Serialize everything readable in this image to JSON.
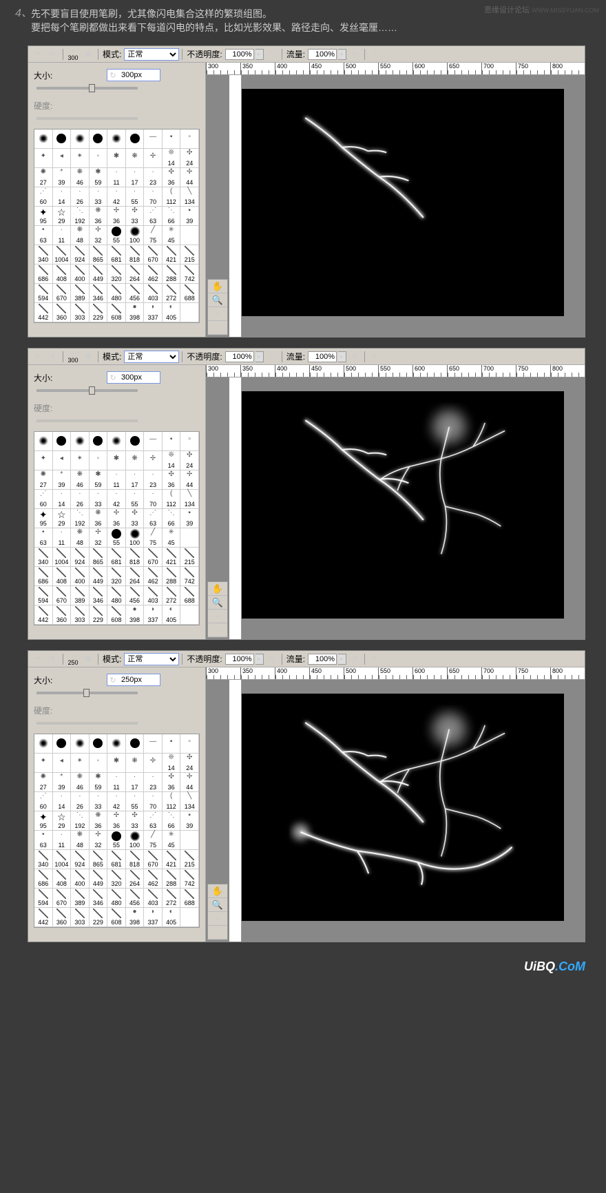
{
  "step_number": "4、",
  "instruction_line1": "先不要盲目使用笔刷，尤其像闪电集合这样的繁琐组图。",
  "instruction_line2": "要把每个笔刷都做出来看下每道闪电的特点，比如光影效果、路径走向、发丝毫厘……",
  "watermark": "思缘设计论坛",
  "watermark_url": "WWW.MISSYUAN.COM",
  "toolbar": {
    "mode_label": "模式:",
    "mode_value": "正常",
    "opacity_label": "不透明度:",
    "opacity_value": "100%",
    "flow_label": "流量:",
    "flow_value": "100%"
  },
  "brush_panel": {
    "size_label": "大小:",
    "hardness_label": "硬度:"
  },
  "panels": [
    {
      "brush_size_num": "300",
      "size_value": "300px",
      "lightning_count": 1,
      "slider_pos": "52%"
    },
    {
      "brush_size_num": "300",
      "size_value": "300px",
      "lightning_count": 2,
      "slider_pos": "52%"
    },
    {
      "brush_size_num": "250",
      "size_value": "250px",
      "lightning_count": 3,
      "slider_pos": "46%"
    }
  ],
  "ruler_ticks": [
    "300",
    "350",
    "400",
    "450",
    "500",
    "550",
    "600",
    "650",
    "700",
    "750",
    "800"
  ],
  "brush_grid": [
    [
      {
        "s": "circle-soft",
        "v": ""
      },
      {
        "s": "circle-solid",
        "v": ""
      },
      {
        "s": "circle-soft",
        "v": ""
      },
      {
        "s": "circle-solid",
        "v": ""
      },
      {
        "s": "circle-soft",
        "v": ""
      },
      {
        "s": "circle-solid",
        "v": ""
      },
      {
        "s": "scatter",
        "v": "",
        "t": "—"
      },
      {
        "s": "scatter",
        "v": "",
        "t": "▪"
      },
      {
        "s": "scatter",
        "v": "",
        "t": "▫"
      }
    ],
    [
      {
        "s": "scatter",
        "v": "",
        "t": "✦"
      },
      {
        "s": "scatter",
        "v": "",
        "t": "◂"
      },
      {
        "s": "scatter",
        "v": "",
        "t": "✴"
      },
      {
        "s": "scatter",
        "v": "",
        "t": "◦"
      },
      {
        "s": "scatter",
        "v": "",
        "t": "✱"
      },
      {
        "s": "scatter",
        "v": "",
        "t": "❋"
      },
      {
        "s": "scatter",
        "v": "",
        "t": "✢"
      },
      {
        "s": "scatter",
        "v": "14",
        "t": "❊"
      },
      {
        "s": "scatter",
        "v": "24",
        "t": "✣"
      }
    ],
    [
      {
        "s": "scatter",
        "v": "27",
        "t": "✺"
      },
      {
        "s": "scatter",
        "v": "39",
        "t": "*"
      },
      {
        "s": "scatter",
        "v": "46",
        "t": "❋"
      },
      {
        "s": "scatter",
        "v": "59",
        "t": "✱"
      },
      {
        "s": "scatter",
        "v": "11",
        "t": "·"
      },
      {
        "s": "scatter",
        "v": "17",
        "t": "·"
      },
      {
        "s": "scatter",
        "v": "23",
        "t": "·"
      },
      {
        "s": "scatter",
        "v": "36",
        "t": "✣"
      },
      {
        "s": "scatter",
        "v": "44",
        "t": "✢"
      }
    ],
    [
      {
        "s": "scatter",
        "v": "60",
        "t": "⋰"
      },
      {
        "s": "scatter",
        "v": "14",
        "t": "·"
      },
      {
        "s": "scatter",
        "v": "26",
        "t": "·"
      },
      {
        "s": "scatter",
        "v": "33",
        "t": "·"
      },
      {
        "s": "scatter",
        "v": "42",
        "t": "·"
      },
      {
        "s": "scatter",
        "v": "55",
        "t": "·"
      },
      {
        "s": "scatter",
        "v": "70",
        "t": "·"
      },
      {
        "s": "scatter",
        "v": "112",
        "t": "("
      },
      {
        "s": "scatter",
        "v": "134",
        "t": "╲"
      }
    ],
    [
      {
        "s": "star",
        "v": "95",
        "t": "✦"
      },
      {
        "s": "star",
        "v": "29",
        "t": "☆"
      },
      {
        "s": "scatter",
        "v": "192",
        "t": "⋱"
      },
      {
        "s": "scatter",
        "v": "36",
        "t": "❋"
      },
      {
        "s": "scatter",
        "v": "36",
        "t": "✢"
      },
      {
        "s": "scatter",
        "v": "33",
        "t": "✣"
      },
      {
        "s": "scatter",
        "v": "63",
        "t": "⋰"
      },
      {
        "s": "scatter",
        "v": "66",
        "t": "⋱"
      },
      {
        "s": "scatter",
        "v": "39",
        "t": "▪"
      }
    ],
    [
      {
        "s": "scatter",
        "v": "63",
        "t": "•"
      },
      {
        "s": "scatter",
        "v": "11",
        "t": "·"
      },
      {
        "s": "scatter",
        "v": "48",
        "t": "❋"
      },
      {
        "s": "scatter",
        "v": "32",
        "t": "✢"
      },
      {
        "s": "circle-solid",
        "v": "55"
      },
      {
        "s": "circle-med",
        "v": "100"
      },
      {
        "s": "scatter",
        "v": "75",
        "t": "╱"
      },
      {
        "s": "scatter",
        "v": "45",
        "t": "✳"
      },
      {
        "s": "",
        "v": ""
      }
    ],
    [
      {
        "s": "stroke",
        "v": "340"
      },
      {
        "s": "stroke",
        "v": "1004"
      },
      {
        "s": "stroke",
        "v": "924"
      },
      {
        "s": "stroke",
        "v": "865"
      },
      {
        "s": "stroke",
        "v": "681"
      },
      {
        "s": "stroke",
        "v": "818"
      },
      {
        "s": "stroke",
        "v": "670"
      },
      {
        "s": "stroke",
        "v": "421"
      },
      {
        "s": "stroke",
        "v": "215"
      }
    ],
    [
      {
        "s": "stroke",
        "v": "686"
      },
      {
        "s": "stroke",
        "v": "408"
      },
      {
        "s": "stroke",
        "v": "400"
      },
      {
        "s": "stroke",
        "v": "449"
      },
      {
        "s": "stroke",
        "v": "320"
      },
      {
        "s": "stroke",
        "v": "264"
      },
      {
        "s": "stroke",
        "v": "462"
      },
      {
        "s": "stroke",
        "v": "288"
      },
      {
        "s": "stroke",
        "v": "742"
      }
    ],
    [
      {
        "s": "stroke",
        "v": "594"
      },
      {
        "s": "stroke",
        "v": "670"
      },
      {
        "s": "stroke",
        "v": "389"
      },
      {
        "s": "stroke",
        "v": "346"
      },
      {
        "s": "stroke",
        "v": "480"
      },
      {
        "s": "stroke",
        "v": "456"
      },
      {
        "s": "stroke",
        "v": "403"
      },
      {
        "s": "stroke",
        "v": "272"
      },
      {
        "s": "stroke",
        "v": "688"
      }
    ],
    [
      {
        "s": "stroke",
        "v": "442"
      },
      {
        "s": "stroke",
        "v": "360"
      },
      {
        "s": "stroke",
        "v": "303"
      },
      {
        "s": "stroke",
        "v": "229"
      },
      {
        "s": "stroke",
        "v": "608"
      },
      {
        "s": "scatter",
        "v": "398",
        "t": "●"
      },
      {
        "s": "scatter",
        "v": "337",
        "t": "◗"
      },
      {
        "s": "scatter",
        "v": "405",
        "t": "◐"
      },
      {
        "s": "",
        "v": ""
      }
    ]
  ],
  "mini_tools": [
    "✋",
    "🔍",
    "▪",
    "▫"
  ],
  "footer_brand": "UiBQ",
  "footer_domain": ".CoM"
}
